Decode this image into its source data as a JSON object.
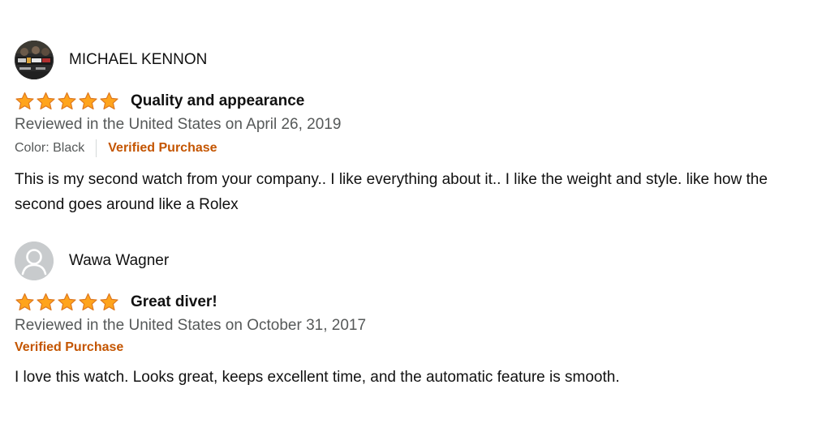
{
  "reviews": [
    {
      "author": "MICHAEL KENNON",
      "avatar": "profile-photo",
      "rating": 5,
      "title": "Quality and appearance",
      "date": "Reviewed in the United States on April 26, 2019",
      "color_variant": "Color: Black",
      "verified": "Verified Purchase",
      "body": "This is my second watch from your company.. I like everything about it.. I like the weight and style. like how the second goes around like a Rolex"
    },
    {
      "author": "Wawa Wagner",
      "avatar": "default-avatar",
      "rating": 5,
      "title": "Great diver!",
      "date": "Reviewed in the United States on October 31, 2017",
      "verified": "Verified Purchase",
      "body": "I love this watch. Looks great, keeps excellent time, and the automatic feature is smooth."
    }
  ],
  "colors": {
    "star_fill": "#FFA41C",
    "star_stroke": "#DE7921",
    "verified": "#C45500",
    "secondary_text": "#565959"
  }
}
